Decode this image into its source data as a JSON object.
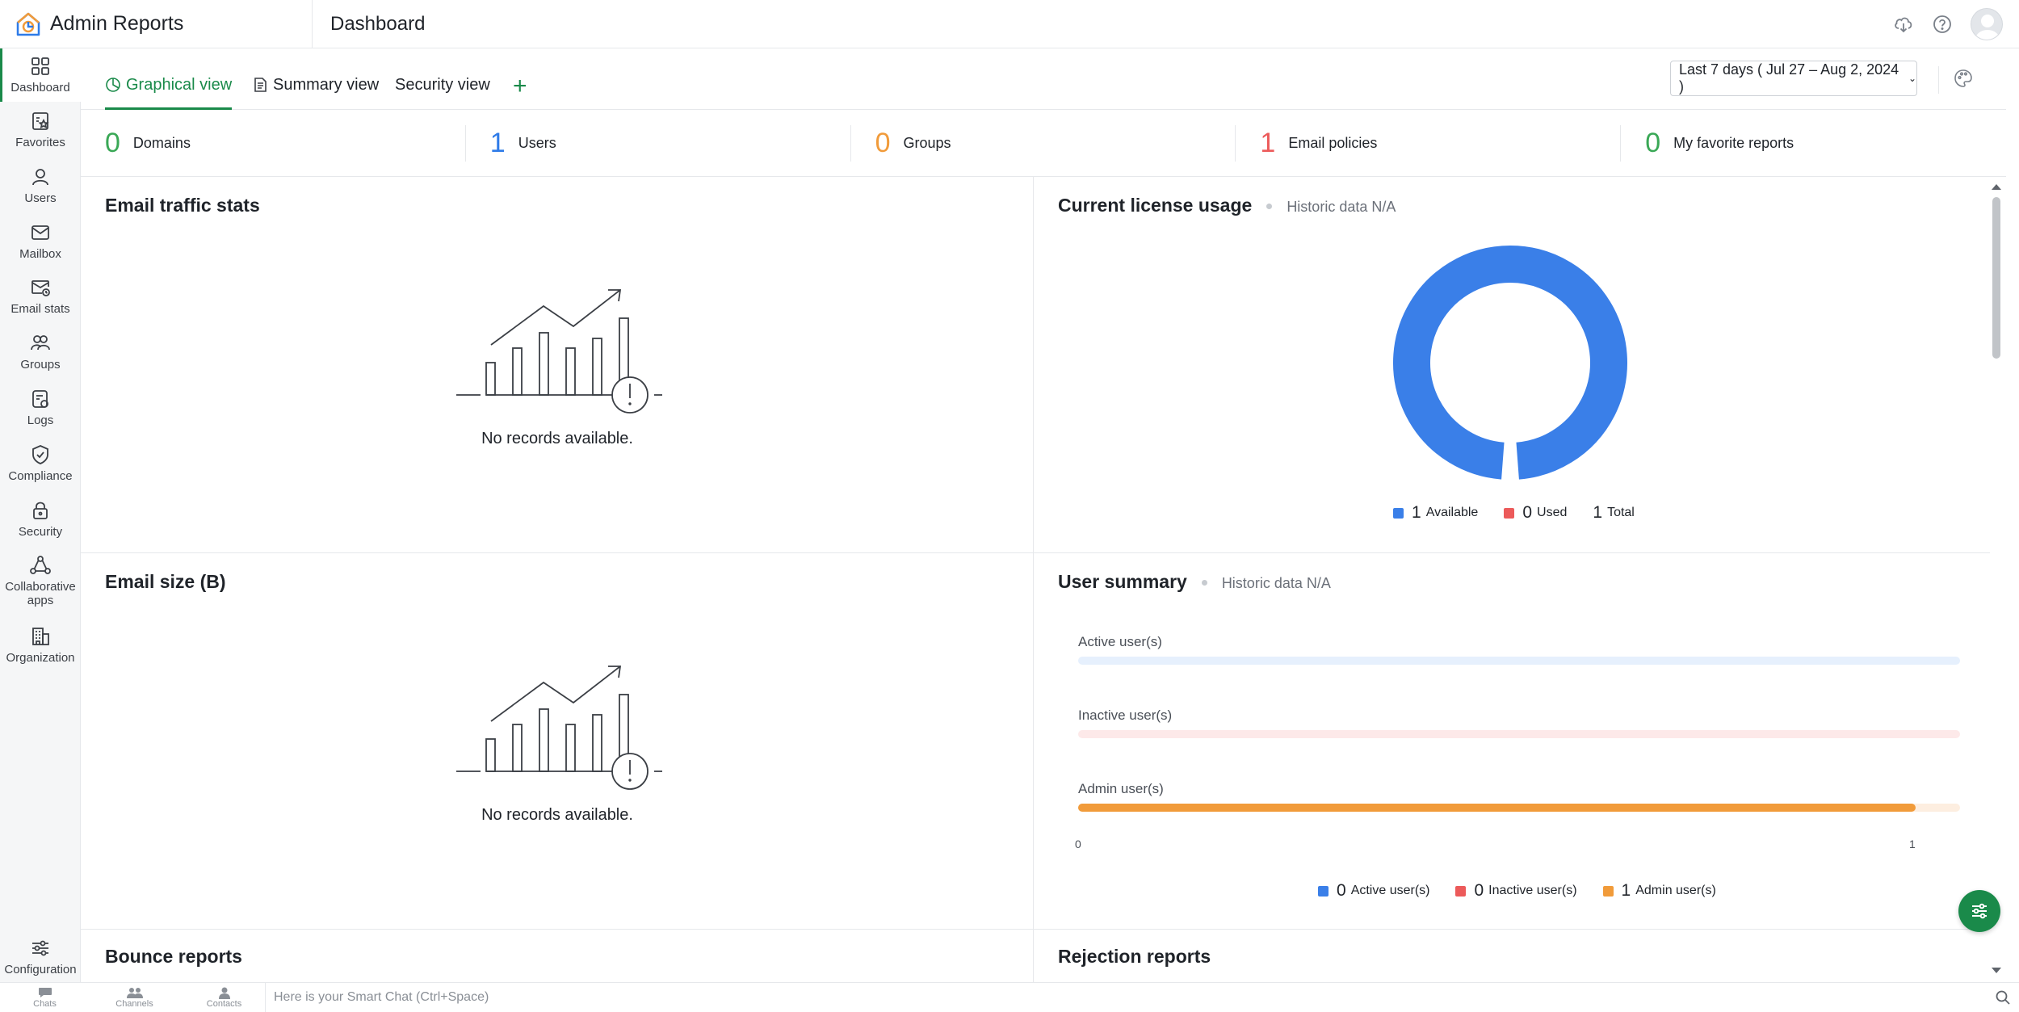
{
  "app": {
    "title": "Admin Reports",
    "page_title": "Dashboard"
  },
  "sidebar": {
    "items": [
      {
        "label": "Dashboard",
        "icon": "dashboard-icon",
        "active": true
      },
      {
        "label": "Favorites",
        "icon": "favorites-icon"
      },
      {
        "label": "Users",
        "icon": "user-icon"
      },
      {
        "label": "Mailbox",
        "icon": "mailbox-icon"
      },
      {
        "label": "Email stats",
        "icon": "email-stats-icon"
      },
      {
        "label": "Groups",
        "icon": "groups-icon"
      },
      {
        "label": "Logs",
        "icon": "logs-icon"
      },
      {
        "label": "Compliance",
        "icon": "shield-check-icon"
      },
      {
        "label": "Security",
        "icon": "lock-icon"
      },
      {
        "label": "Collaborative apps",
        "icon": "collaborative-apps-icon"
      },
      {
        "label": "Organization",
        "icon": "organization-icon"
      }
    ],
    "configuration": "Configuration"
  },
  "tabs": [
    {
      "label": "Graphical view",
      "icon": "pie-chart-icon",
      "active": true
    },
    {
      "label": "Summary view",
      "icon": "document-icon"
    },
    {
      "label": "Security view"
    }
  ],
  "tab_add": "+",
  "date_range": "Last 7 days ( Jul 27 – Aug 2, 2024 )",
  "counters": [
    {
      "value": "0",
      "label": "Domains",
      "color": "#3aa856"
    },
    {
      "value": "1",
      "label": "Users",
      "color": "#2e7be8"
    },
    {
      "value": "0",
      "label": "Groups",
      "color": "#f19b3a"
    },
    {
      "value": "1",
      "label": "Email policies",
      "color": "#ec5a5a"
    },
    {
      "value": "0",
      "label": "My favorite reports",
      "color": "#3aa856"
    }
  ],
  "panels": {
    "email_traffic": {
      "title": "Email traffic stats",
      "empty": "No records available."
    },
    "license": {
      "title": "Current license usage",
      "subtitle": "Historic data N/A",
      "legend": [
        {
          "value": "1",
          "label": "Available",
          "color": "#3a7fe8"
        },
        {
          "value": "0",
          "label": "Used",
          "color": "#ec5a5a"
        },
        {
          "value": "1",
          "label": "Total"
        }
      ]
    },
    "email_size": {
      "title": "Email size (B)",
      "empty": "No records available."
    },
    "user_summary": {
      "title": "User summary",
      "subtitle": "Historic data N/A",
      "axis_min": "0",
      "axis_max": "1",
      "legend": [
        {
          "value": "0",
          "label": "Active user(s)",
          "color": "#3a7fe8"
        },
        {
          "value": "0",
          "label": "Inactive user(s)",
          "color": "#ec5a5a"
        },
        {
          "value": "1",
          "label": "Admin user(s)",
          "color": "#f19b3a"
        }
      ]
    },
    "bounce": {
      "title": "Bounce reports"
    },
    "rejection": {
      "title": "Rejection reports"
    }
  },
  "chart_data": [
    {
      "type": "pie",
      "categories": [
        "Available",
        "Used"
      ],
      "values": [
        1,
        0
      ]
    },
    {
      "type": "bar",
      "orientation": "horizontal",
      "categories": [
        "Active user(s)",
        "Inactive user(s)",
        "Admin user(s)"
      ],
      "values": [
        0,
        0,
        1
      ],
      "colors": [
        "#3a7fe8",
        "#ec5a5a",
        "#f19b3a"
      ],
      "xlim": [
        0,
        1
      ]
    }
  ],
  "chatbar": {
    "tabs": [
      "Chats",
      "Channels",
      "Contacts"
    ],
    "placeholder": "Here is your Smart Chat (Ctrl+Space)"
  }
}
